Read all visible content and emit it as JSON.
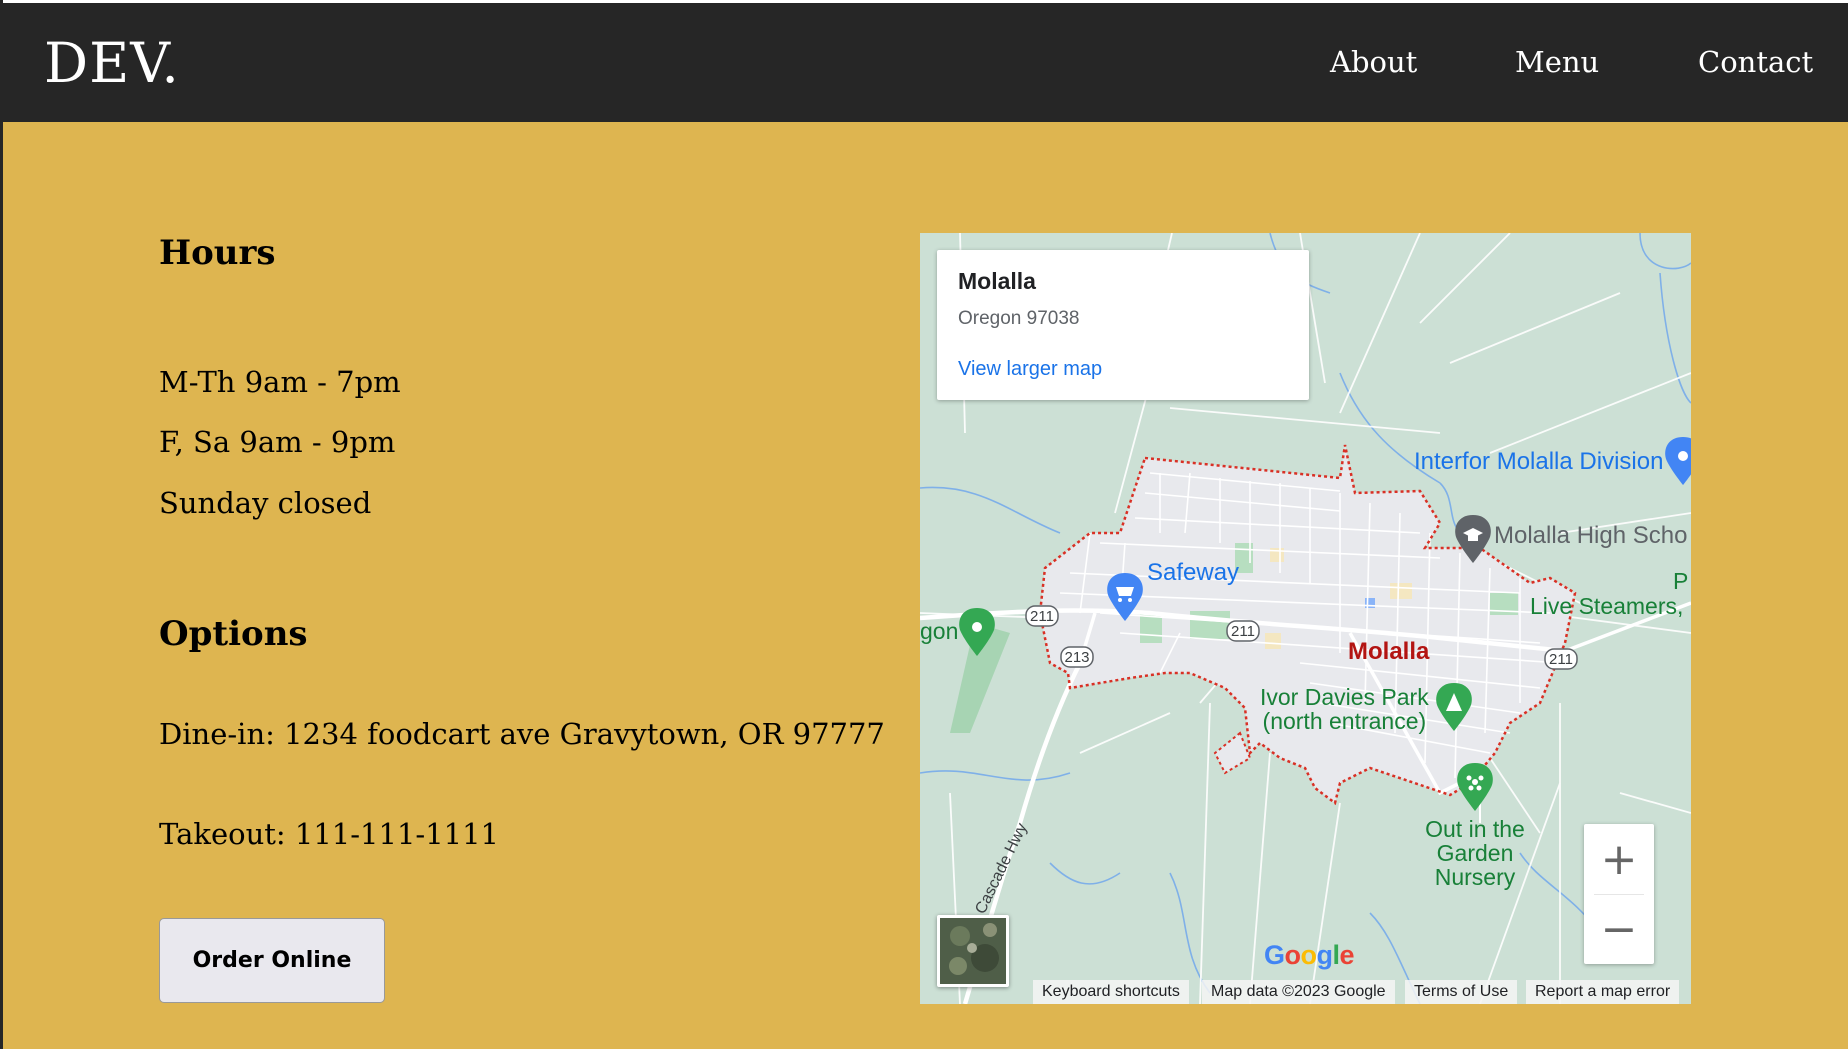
{
  "nav": {
    "logo": "DEV.",
    "links": [
      "About",
      "Menu",
      "Contact"
    ]
  },
  "hours": {
    "heading": "Hours",
    "lines": [
      "M-Th 9am - 7pm",
      "F, Sa 9am - 9pm",
      "Sunday closed"
    ]
  },
  "options": {
    "heading": "Options",
    "dine_in": "Dine-in: 1234 foodcart ave Gravytown, OR 97777",
    "takeout": "Takeout: 111-111-1111",
    "order_label": "Order Online"
  },
  "map": {
    "info_title": "Molalla",
    "info_sub": "Oregon 97038",
    "info_link": "View larger map",
    "labels": {
      "interfor": "Interfor Molalla Division",
      "high_school": "Molalla High Scho",
      "safeway": "Safeway",
      "live_steamers": "Live Steamers,",
      "p_partial": "P",
      "gon_partial": "gon",
      "city": "Molalla",
      "park_line1": "Ivor Davies Park",
      "park_line2": "(north entrance)",
      "nursery_line1": "Out in the",
      "nursery_line2": "Garden",
      "nursery_line3": "Nursery",
      "cascade_hwy": "Cascade Hwy"
    },
    "route_shields": [
      "211",
      "211",
      "213",
      "211"
    ],
    "zoom_in": "+",
    "zoom_out": "−",
    "google_logo": "Google",
    "attribution": [
      "Keyboard shortcuts",
      "Map data ©2023 Google",
      "Terms of Use",
      "Report a map error"
    ],
    "colors": {
      "land": "#CCE0D5",
      "urban": "#E8E9ED",
      "boundary": "#D93025",
      "water": "#7FB0E8",
      "link": "#1a73e8",
      "green_label": "#188038",
      "city_label": "#b31412"
    }
  },
  "colors": {
    "page_background": "#DEB550",
    "nav_background": "#262626"
  }
}
